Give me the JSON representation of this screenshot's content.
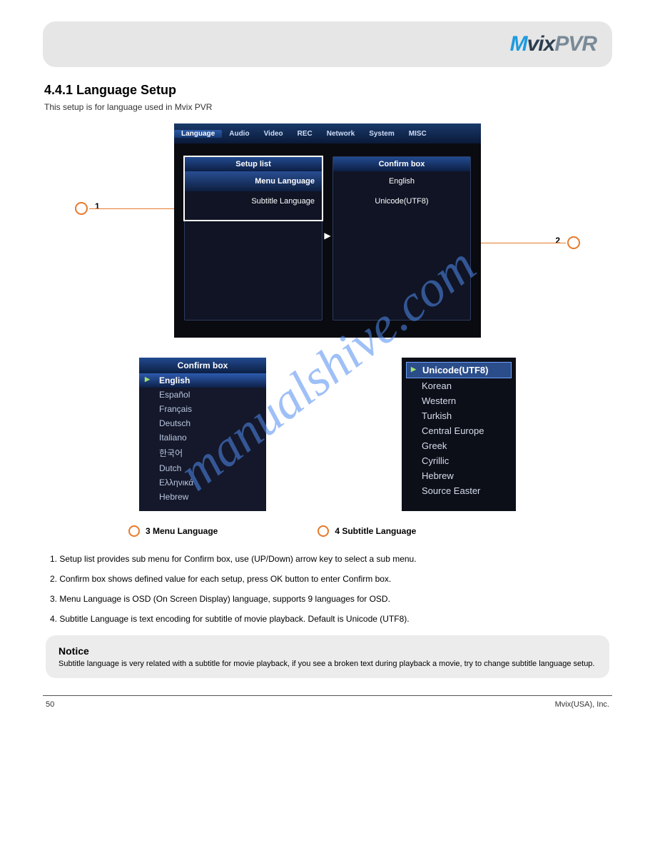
{
  "header": {
    "logo_mvix_m": "M",
    "logo_mvix_vix": "vix",
    "logo_pvr": "PVR"
  },
  "section": {
    "title": "4.4.1 Language Setup",
    "subtitle": "This setup is for language used in Mvix PVR"
  },
  "main_shot": {
    "tabs": [
      "Language",
      "Audio",
      "Video",
      "REC",
      "Network",
      "System",
      "MISC"
    ],
    "setup_list_title": "Setup list",
    "confirm_box_title": "Confirm box",
    "menu_language_label": "Menu Language",
    "subtitle_language_label": "Subtitle Language",
    "confirm_english": "English",
    "confirm_unicode": "Unicode(UTF8)",
    "annotation_1": "1",
    "annotation_2": "2"
  },
  "confirm_shot": {
    "title": "Confirm box",
    "items": [
      "English",
      "Español",
      "Français",
      "Deutsch",
      "Italiano",
      "한국어",
      "Dutch",
      "Ελληνικά",
      "Hebrew"
    ]
  },
  "encoding_shot": {
    "items": [
      "Unicode(UTF8)",
      "Korean",
      "Western",
      "Turkish",
      "Central Europe",
      "Greek",
      "Cyrillic",
      "Hebrew",
      "Source Easter"
    ]
  },
  "lower_labels": {
    "label3": "3 Menu Language",
    "label4": "4 Subtitle Language"
  },
  "body": {
    "p1": "1. Setup list provides sub menu for Confirm box, use (UP/Down) arrow key to select a sub menu.",
    "p2": "2. Confirm box shows defined value for each setup, press OK button to enter Confirm box.",
    "p3": "3. Menu Language is OSD (On Screen Display) language, supports 9 languages for OSD.",
    "p4": "4. Subtitle Language is text encoding for subtitle of movie playback. Default is Unicode (UTF8)."
  },
  "note": {
    "title": "Notice",
    "body": "Subtitle language is very related with a subtitle for movie playback, if you see a broken text during playback a movie, try to change subtitle language setup."
  },
  "footer": {
    "page": "50",
    "text": "Mvix(USA), Inc."
  },
  "watermark": "manualshive.com"
}
